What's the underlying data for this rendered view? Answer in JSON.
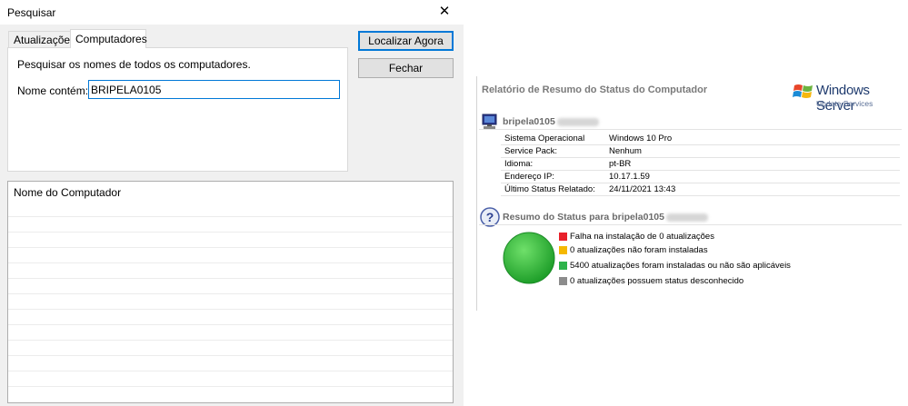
{
  "dialog": {
    "title": "Pesquisar",
    "close_glyph": "✕",
    "tabs": [
      {
        "label": "Atualizações",
        "active": false
      },
      {
        "label": "Computadores",
        "active": true
      }
    ],
    "description": "Pesquisar os nomes de todos os computadores.",
    "name_label": "Nome contém:",
    "name_value": "BRIPELA0105",
    "find_button": "Localizar Agora",
    "close_button": "Fechar",
    "results_header": "Nome do Computador"
  },
  "report": {
    "title": "Relatório de Resumo do Status do Computador",
    "logo_main": "Windows Server",
    "logo_sub": "Update Services",
    "computer_name": "bripela0105",
    "info": [
      {
        "key": "Sistema Operacional",
        "value": "Windows 10 Pro"
      },
      {
        "key": "Service Pack:",
        "value": "Nenhum"
      },
      {
        "key": "Idioma:",
        "value": "pt-BR"
      },
      {
        "key": "Endereço IP:",
        "value": "10.17.1.59"
      },
      {
        "key": "Último Status Relatado:",
        "value": "24/11/2021 13:43"
      }
    ],
    "status_heading": "Resumo do Status para bripela0105",
    "legend": [
      {
        "text": "Falha na instalação de 0 atualizações",
        "color": "#e8202a"
      },
      {
        "text": "0 atualizações não foram instaladas",
        "color": "#f5b800"
      },
      {
        "text": "5400 atualizações foram instaladas ou não são aplicáveis",
        "color": "#2db34a"
      },
      {
        "text": "0 atualizações possuem status desconhecido",
        "color": "#8c8c8c"
      }
    ]
  },
  "icons": {
    "close": "close-icon",
    "computer": "computer-icon",
    "help": "question-icon",
    "windows_logo": "windows-flag-icon",
    "status_pie": "status-pie-icon"
  }
}
